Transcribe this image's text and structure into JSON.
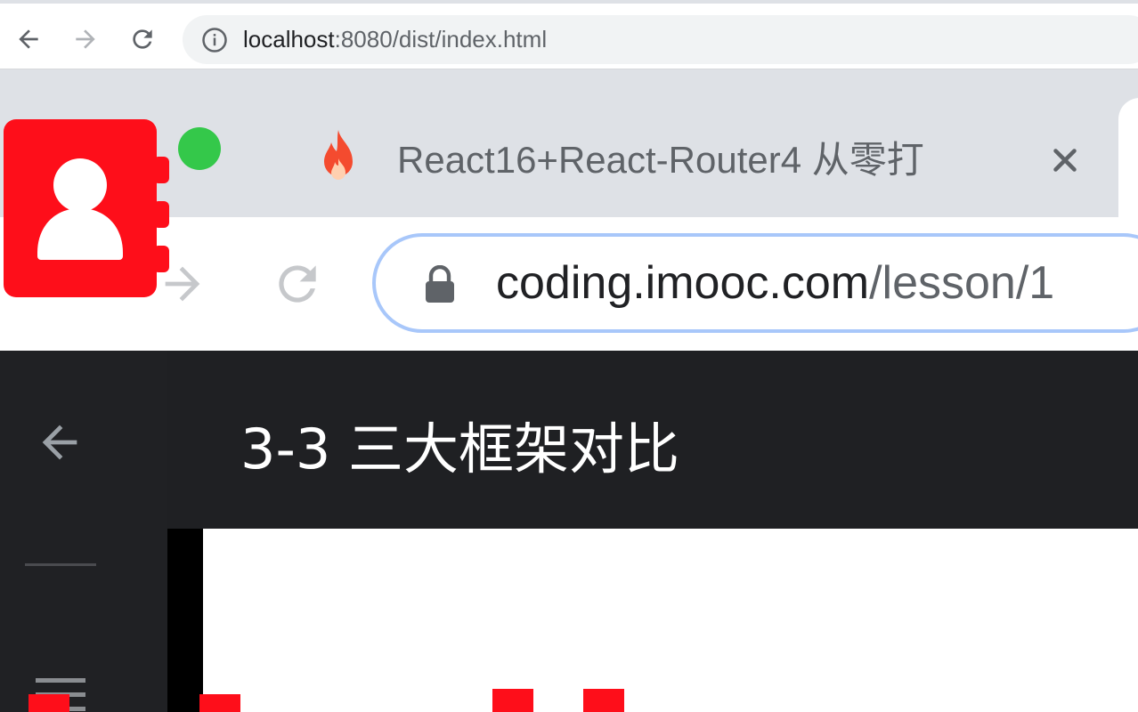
{
  "outer_browser": {
    "url_host": "localhost",
    "url_rest": ":8080/dist/index.html"
  },
  "inner_browser": {
    "tab_title": "React16+React-Router4 从零打",
    "url_host": "coding.imooc.com",
    "url_rest": "/lesson/1"
  },
  "page": {
    "lesson_title": "3-3 三大框架对比"
  },
  "colors": {
    "app_red": "#fe0e1a",
    "green_dot": "#34c84a",
    "dark_header": "#1f2023",
    "sidebar": "#202124"
  },
  "icons": {
    "outer_back": "arrow-left-icon",
    "outer_forward": "arrow-right-icon",
    "outer_reload": "reload-icon",
    "outer_info": "info-circle-icon",
    "contacts": "contacts-book-icon",
    "tab_favicon": "flame-icon",
    "tab_close": "close-icon",
    "inner_lock": "lock-icon",
    "page_back": "arrow-left-icon",
    "page_menu": "menu-icon"
  }
}
